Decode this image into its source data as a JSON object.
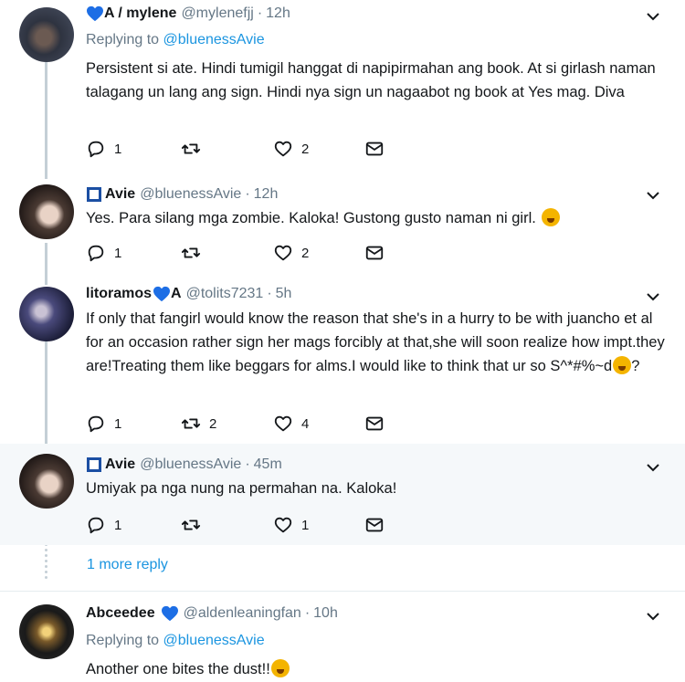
{
  "tweets": [
    {
      "name": "A / mylene",
      "handle": "@mylenefjj",
      "sep": "·",
      "time": "12h",
      "replying_prefix": "Replying to",
      "replying_to": "@bluenessAvie",
      "text": "Persistent si ate. Hindi tumigil hanggat di napipirmahan ang book. At si girlash naman talagang un lang ang sign. Hindi nya sign un nagaabot ng book at Yes mag. Diva",
      "replies": "1",
      "retweets": "",
      "likes": "2"
    },
    {
      "name": "Avie",
      "handle": "@bluenessAvie",
      "sep": "·",
      "time": "12h",
      "text": "Yes. Para silang mga zombie. Kaloka! Gustong gusto naman ni girl.",
      "replies": "1",
      "retweets": "",
      "likes": "2"
    },
    {
      "name": "litoramos",
      "name_suffix": "A",
      "handle": "@tolits7231",
      "sep": "·",
      "time": "5h",
      "text": "If only that fangirl would know the reason that she's in a hurry to be with juancho et al for an occasion rather sign her mags forcibly at that,she will soon realize how impt.they are!Treating them like beggars for alms.I would like to think that ur so S^*#%~d",
      "text_end": "?",
      "replies": "1",
      "retweets": "2",
      "likes": "4"
    },
    {
      "name": "Avie",
      "handle": "@bluenessAvie",
      "sep": "·",
      "time": "45m",
      "text": "Umiyak pa nga nung na permahan na. Kaloka!",
      "replies": "1",
      "retweets": "",
      "likes": "1"
    },
    {
      "name": "Abceedee",
      "handle": "@aldenleaningfan",
      "sep": "·",
      "time": "10h",
      "replying_prefix": "Replying to",
      "replying_to": "@bluenessAvie",
      "text": "Another one bites the dust!!"
    }
  ],
  "more_reply": "1 more reply",
  "icons": [
    "reply-icon",
    "retweet-icon",
    "like-icon",
    "dm-icon",
    "chevron-down-icon",
    "blue-heart-icon",
    "verified-box-icon",
    "laughing-emoji-icon"
  ],
  "colors": {
    "accent": "#1b95e0",
    "muted": "#657786",
    "text": "#14171a",
    "highlight": "#f5f8fa",
    "heart": "#1d6ee5"
  }
}
